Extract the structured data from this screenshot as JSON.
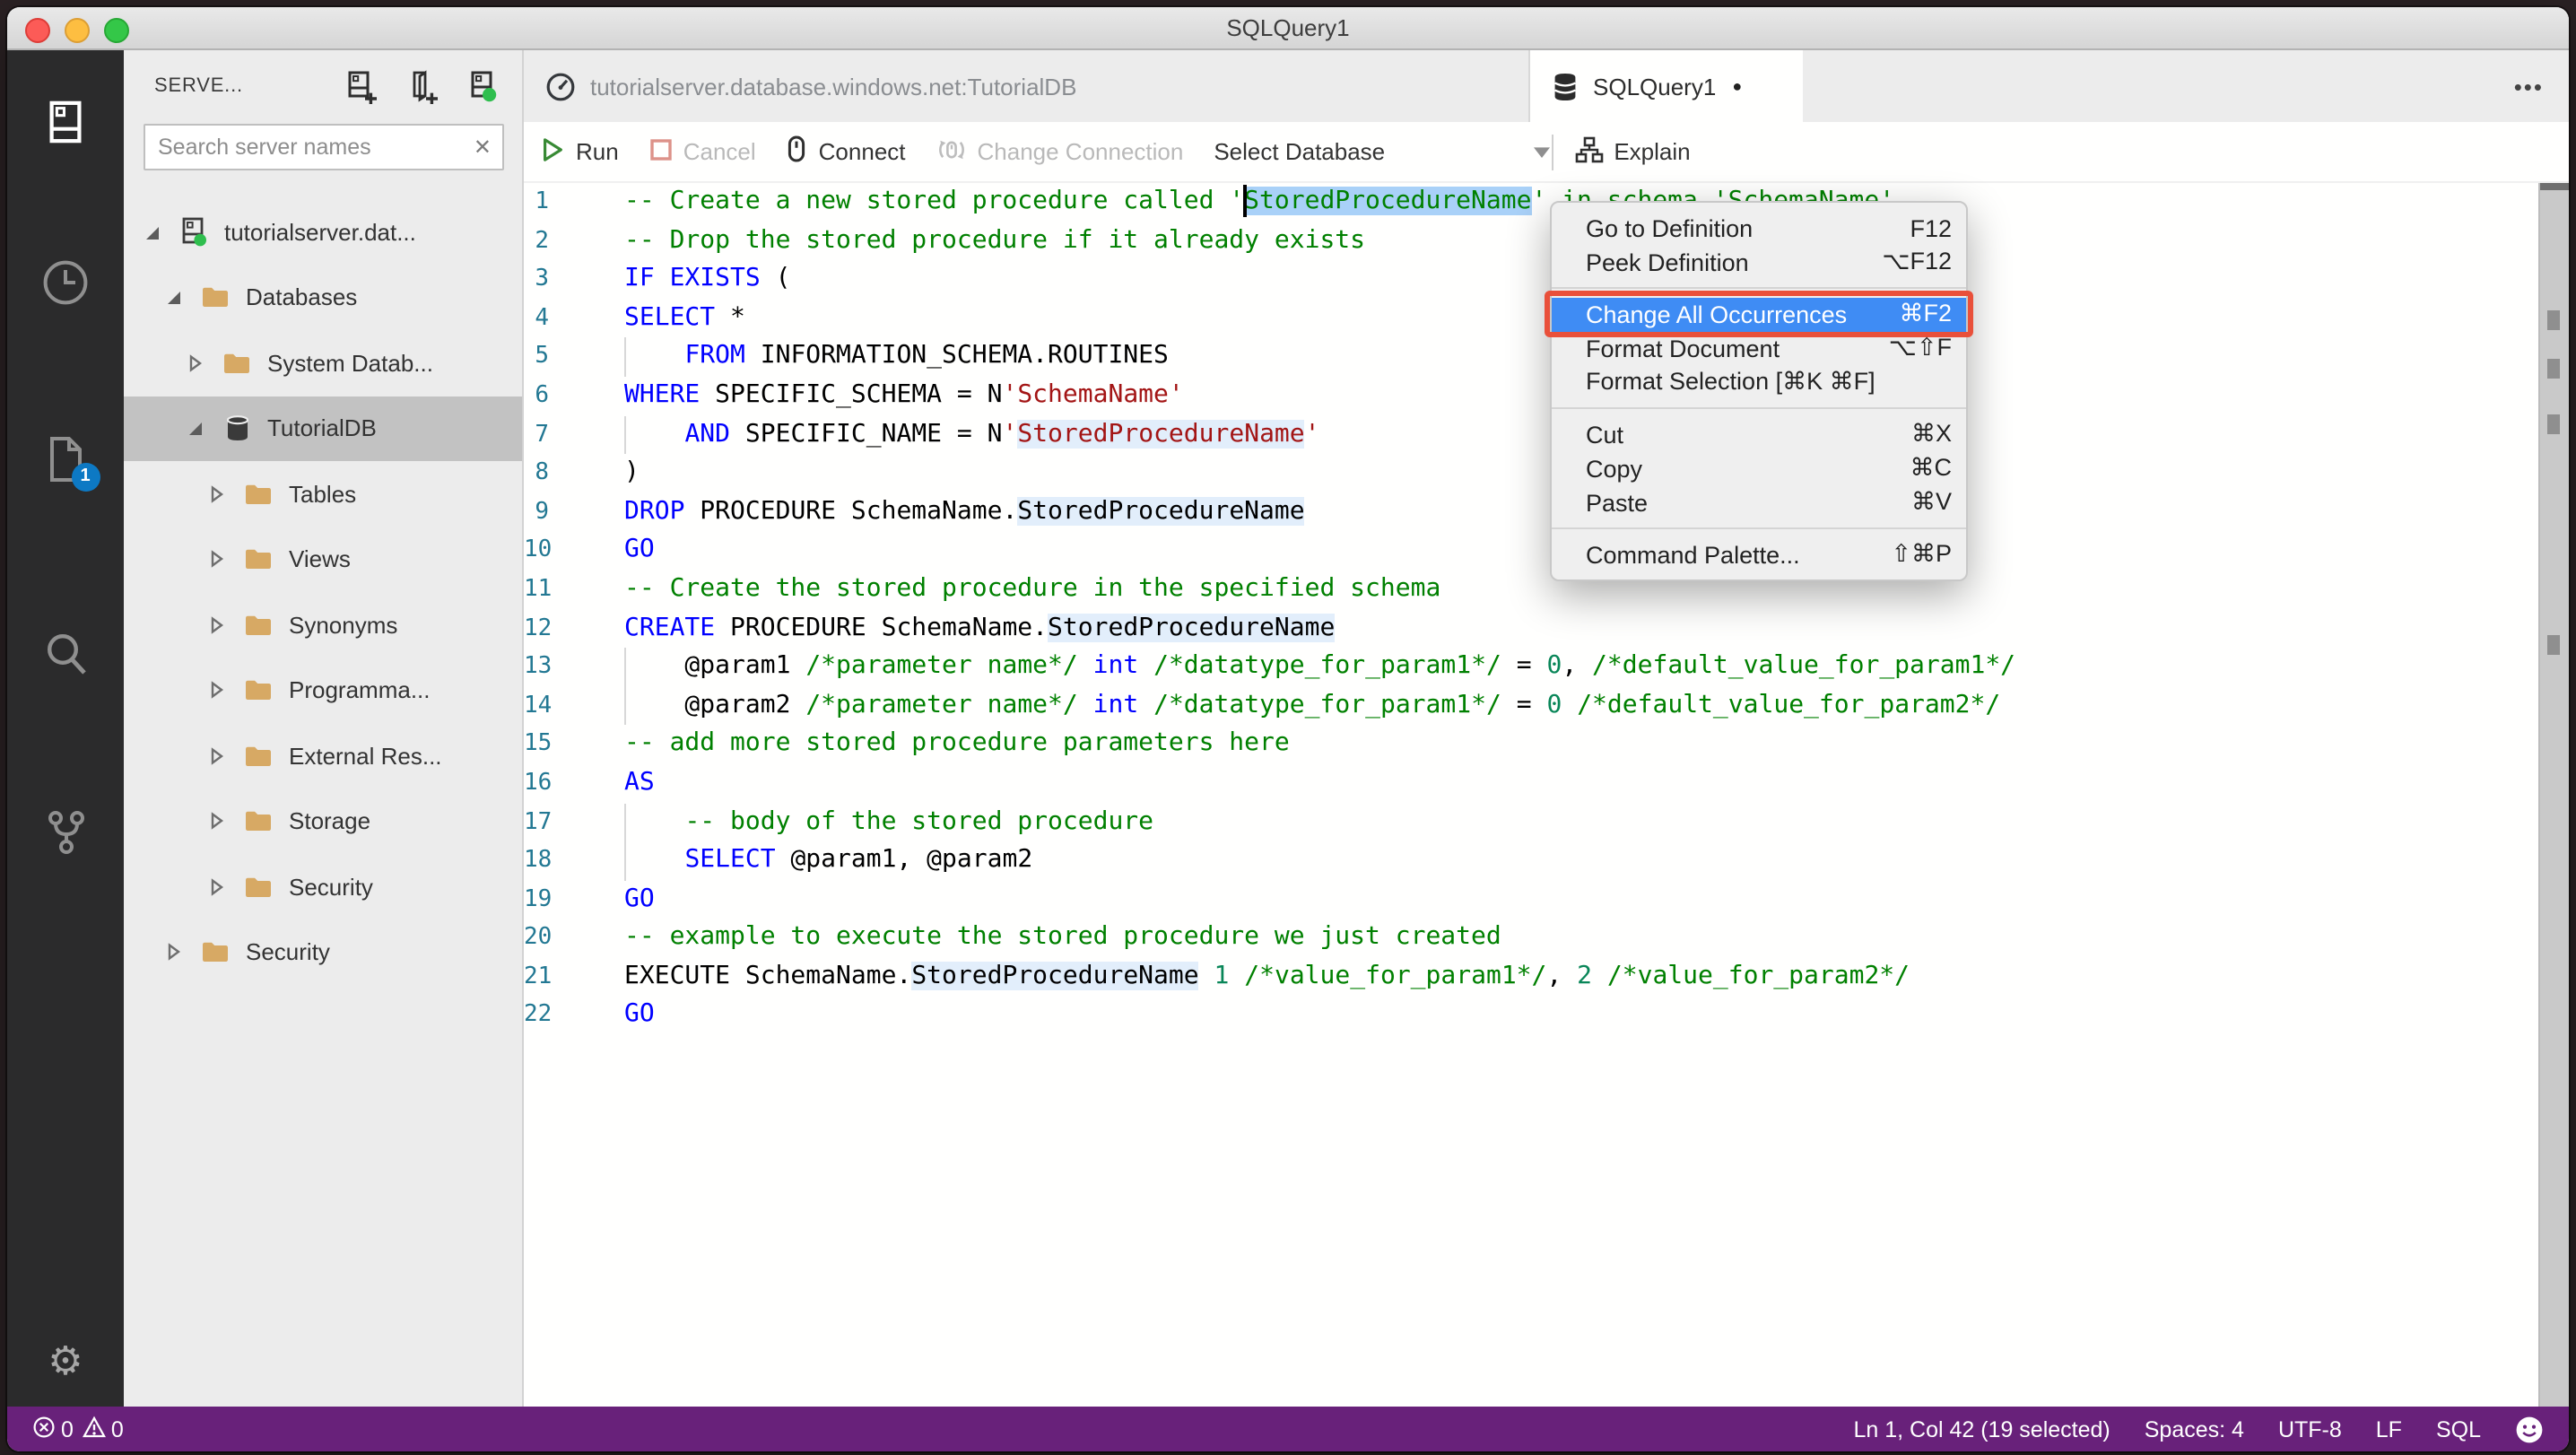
{
  "colors": {
    "kw": "#0000ff",
    "cm": "#008000",
    "str": "#a31515",
    "num": "#098658",
    "ln": "#237893",
    "sel": "#a9d1f8",
    "hl": "#e2eefb",
    "status": "#68217a",
    "menuhl": "#3f8cf4",
    "annot": "#e9503a",
    "folder": "#d7a964",
    "badge": "#0d79c4",
    "green": "#2fbe4e",
    "rungreen": "#388a34",
    "cancelred": "#dd9289"
  },
  "window": {
    "title": "SQLQuery1"
  },
  "activity_bar": {
    "items": [
      {
        "name": "servers",
        "icon": "servers-icon",
        "active": true
      },
      {
        "name": "task-history",
        "icon": "clock-icon",
        "active": false
      },
      {
        "name": "open-editors",
        "icon": "file-icon",
        "active": false,
        "badge": "1"
      },
      {
        "name": "search",
        "icon": "search-icon",
        "active": false
      },
      {
        "name": "source-control",
        "icon": "git-branch-icon",
        "active": false
      }
    ],
    "settings_icon": "⚙"
  },
  "sidebar": {
    "header": {
      "title": "SERVE...",
      "icons": [
        "new-connection-icon",
        "new-server-group-icon",
        "active-connections-icon"
      ]
    },
    "search": {
      "placeholder": "Search server names",
      "clear_icon": "✕"
    },
    "tree": [
      {
        "label": "tutorialserver.dat...",
        "level": 0,
        "state": "open",
        "icon": "server",
        "selected": false
      },
      {
        "label": "Databases",
        "level": 1,
        "state": "open",
        "icon": "folder",
        "selected": false
      },
      {
        "label": "System Datab...",
        "level": 2,
        "state": "closed",
        "icon": "folder",
        "selected": false
      },
      {
        "label": "TutorialDB",
        "level": 2,
        "state": "open",
        "icon": "database",
        "selected": true
      },
      {
        "label": "Tables",
        "level": 3,
        "state": "closed",
        "icon": "folder",
        "selected": false
      },
      {
        "label": "Views",
        "level": 3,
        "state": "closed",
        "icon": "folder",
        "selected": false
      },
      {
        "label": "Synonyms",
        "level": 3,
        "state": "closed",
        "icon": "folder",
        "selected": false
      },
      {
        "label": "Programma...",
        "level": 3,
        "state": "closed",
        "icon": "folder",
        "selected": false
      },
      {
        "label": "External Res...",
        "level": 3,
        "state": "closed",
        "icon": "folder",
        "selected": false
      },
      {
        "label": "Storage",
        "level": 3,
        "state": "closed",
        "icon": "folder",
        "selected": false
      },
      {
        "label": "Security",
        "level": 3,
        "state": "closed",
        "icon": "folder",
        "selected": false
      },
      {
        "label": "Security",
        "level": 1,
        "state": "closed",
        "icon": "folder",
        "selected": false
      }
    ]
  },
  "tabs": [
    {
      "label": "tutorialserver.database.windows.net:TutorialDB",
      "icon": "dashboard-icon",
      "active": false,
      "modified": false
    },
    {
      "label": "SQLQuery1",
      "icon": "database-icon",
      "active": true,
      "modified": true
    }
  ],
  "tab_actions": "•••",
  "toolbar": {
    "run": "Run",
    "cancel": "Cancel",
    "connect": "Connect",
    "change_connection": "Change Connection",
    "select_database": "Select Database",
    "explain": "Explain"
  },
  "editor": {
    "lines": [
      {
        "n": "1",
        "g": false,
        "s": [
          {
            "t": "-- Create a new stored procedure called '",
            "c": "cm"
          },
          {
            "t": "StoredProcedureName",
            "c": "cm sel"
          },
          {
            "t": "' in schema 'SchemaName'",
            "c": "cm"
          }
        ]
      },
      {
        "n": "2",
        "g": false,
        "s": [
          {
            "t": "-- Drop the stored procedure if it already exists",
            "c": "cm"
          }
        ]
      },
      {
        "n": "3",
        "g": false,
        "s": [
          {
            "t": "IF EXISTS",
            "c": "kw"
          },
          {
            "t": " (",
            "c": "pl"
          }
        ]
      },
      {
        "n": "4",
        "g": false,
        "s": [
          {
            "t": "SELECT",
            "c": "kw"
          },
          {
            "t": " *",
            "c": "pl"
          }
        ]
      },
      {
        "n": "5",
        "g": true,
        "s": [
          {
            "t": "    ",
            "c": "pl"
          },
          {
            "t": "FROM",
            "c": "kw"
          },
          {
            "t": " INFORMATION_SCHEMA.ROUTINES",
            "c": "pl"
          }
        ]
      },
      {
        "n": "6",
        "g": false,
        "s": [
          {
            "t": "WHERE",
            "c": "kw"
          },
          {
            "t": " SPECIFIC_SCHEMA = N",
            "c": "pl"
          },
          {
            "t": "'SchemaName'",
            "c": "str"
          }
        ]
      },
      {
        "n": "7",
        "g": true,
        "s": [
          {
            "t": "    ",
            "c": "pl"
          },
          {
            "t": "AND",
            "c": "kw"
          },
          {
            "t": " SPECIFIC_NAME = N",
            "c": "pl"
          },
          {
            "t": "'",
            "c": "str"
          },
          {
            "t": "StoredProcedureName",
            "c": "str hl"
          },
          {
            "t": "'",
            "c": "str"
          }
        ]
      },
      {
        "n": "8",
        "g": false,
        "s": [
          {
            "t": ")",
            "c": "pl"
          }
        ]
      },
      {
        "n": "9",
        "g": false,
        "s": [
          {
            "t": "DROP",
            "c": "kw"
          },
          {
            "t": " PROCEDURE SchemaName.",
            "c": "pl"
          },
          {
            "t": "StoredProcedureName",
            "c": "pl hl"
          }
        ]
      },
      {
        "n": "10",
        "g": false,
        "s": [
          {
            "t": "GO",
            "c": "kw"
          }
        ]
      },
      {
        "n": "11",
        "g": false,
        "s": [
          {
            "t": "-- Create the stored procedure in the specified schema",
            "c": "cm"
          }
        ]
      },
      {
        "n": "12",
        "g": false,
        "s": [
          {
            "t": "CREATE",
            "c": "kw"
          },
          {
            "t": " PROCEDURE SchemaName.",
            "c": "pl"
          },
          {
            "t": "StoredProcedureName",
            "c": "pl hl"
          }
        ]
      },
      {
        "n": "13",
        "g": true,
        "s": [
          {
            "t": "    @param1 ",
            "c": "pl"
          },
          {
            "t": "/*parameter name*/",
            "c": "cm"
          },
          {
            "t": " ",
            "c": "pl"
          },
          {
            "t": "int",
            "c": "kw"
          },
          {
            "t": " ",
            "c": "pl"
          },
          {
            "t": "/*datatype_for_param1*/",
            "c": "cm"
          },
          {
            "t": " = ",
            "c": "pl"
          },
          {
            "t": "0",
            "c": "num"
          },
          {
            "t": ", ",
            "c": "pl"
          },
          {
            "t": "/*default_value_for_param1*/",
            "c": "cm"
          }
        ]
      },
      {
        "n": "14",
        "g": true,
        "s": [
          {
            "t": "    @param2 ",
            "c": "pl"
          },
          {
            "t": "/*parameter name*/",
            "c": "cm"
          },
          {
            "t": " ",
            "c": "pl"
          },
          {
            "t": "int",
            "c": "kw"
          },
          {
            "t": " ",
            "c": "pl"
          },
          {
            "t": "/*datatype_for_param1*/",
            "c": "cm"
          },
          {
            "t": " = ",
            "c": "pl"
          },
          {
            "t": "0",
            "c": "num"
          },
          {
            "t": " ",
            "c": "pl"
          },
          {
            "t": "/*default_value_for_param2*/",
            "c": "cm"
          }
        ]
      },
      {
        "n": "15",
        "g": false,
        "s": [
          {
            "t": "-- add more stored procedure parameters here",
            "c": "cm"
          }
        ]
      },
      {
        "n": "16",
        "g": false,
        "s": [
          {
            "t": "AS",
            "c": "kw"
          }
        ]
      },
      {
        "n": "17",
        "g": true,
        "s": [
          {
            "t": "    ",
            "c": "pl"
          },
          {
            "t": "-- body of the stored procedure",
            "c": "cm"
          }
        ]
      },
      {
        "n": "18",
        "g": true,
        "s": [
          {
            "t": "    ",
            "c": "pl"
          },
          {
            "t": "SELECT",
            "c": "kw"
          },
          {
            "t": " @param1, @param2",
            "c": "pl"
          }
        ]
      },
      {
        "n": "19",
        "g": false,
        "s": [
          {
            "t": "GO",
            "c": "kw"
          }
        ]
      },
      {
        "n": "20",
        "g": false,
        "s": [
          {
            "t": "-- example to execute the stored procedure we just created",
            "c": "cm"
          }
        ]
      },
      {
        "n": "21",
        "g": false,
        "s": [
          {
            "t": "EXECUTE SchemaName.",
            "c": "pl"
          },
          {
            "t": "StoredProcedureName",
            "c": "pl hl"
          },
          {
            "t": " ",
            "c": "pl"
          },
          {
            "t": "1",
            "c": "num"
          },
          {
            "t": " ",
            "c": "pl"
          },
          {
            "t": "/*value_for_param1*/",
            "c": "cm"
          },
          {
            "t": ", ",
            "c": "pl"
          },
          {
            "t": "2",
            "c": "num"
          },
          {
            "t": " ",
            "c": "pl"
          },
          {
            "t": "/*value_for_param2*/",
            "c": "cm"
          }
        ]
      },
      {
        "n": "22",
        "g": false,
        "s": [
          {
            "t": "GO",
            "c": "kw"
          }
        ]
      }
    ],
    "overview_marks": [
      71,
      98,
      129,
      252
    ]
  },
  "context_menu": {
    "sections": [
      [
        {
          "label": "Go to Definition",
          "shortcut": "F12"
        },
        {
          "label": "Peek Definition",
          "shortcut": "⌥F12"
        }
      ],
      [
        {
          "label": "Change All Occurrences",
          "shortcut": "⌘F2",
          "highlighted": true,
          "annotated": true
        },
        {
          "label": "Format Document",
          "shortcut": "⌥⇧F"
        },
        {
          "label": "Format Selection [⌘K ⌘F]",
          "shortcut": ""
        }
      ],
      [
        {
          "label": "Cut",
          "shortcut": "⌘X"
        },
        {
          "label": "Copy",
          "shortcut": "⌘C"
        },
        {
          "label": "Paste",
          "shortcut": "⌘V"
        }
      ],
      [
        {
          "label": "Command Palette...",
          "shortcut": "⇧⌘P"
        }
      ]
    ]
  },
  "status_bar": {
    "left": [
      {
        "name": "errors",
        "count": "0"
      },
      {
        "name": "warnings",
        "count": "0"
      }
    ],
    "right": [
      {
        "name": "cursor-position",
        "value": "Ln 1, Col 42 (19 selected)"
      },
      {
        "name": "indentation",
        "value": "Spaces: 4"
      },
      {
        "name": "encoding",
        "value": "UTF-8"
      },
      {
        "name": "eol",
        "value": "LF"
      },
      {
        "name": "language-mode",
        "value": "SQL"
      }
    ]
  }
}
